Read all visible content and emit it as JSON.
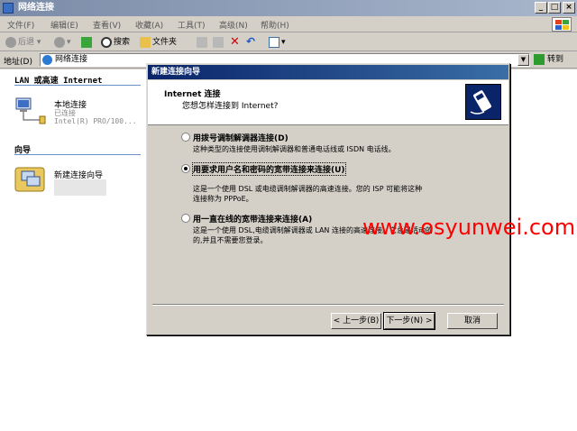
{
  "window": {
    "title": "网络连接"
  },
  "menu": [
    "文件(F)",
    "编辑(E)",
    "查看(V)",
    "收藏(A)",
    "工具(T)",
    "高级(N)",
    "帮助(H)"
  ],
  "toolbar": {
    "back": "后退",
    "search": "搜索",
    "folders": "文件夹"
  },
  "address": {
    "label": "地址(D)",
    "value": "网络连接",
    "go": "转到"
  },
  "sections": {
    "lan_header": "LAN 或高速 Internet",
    "wizard_header": "向导"
  },
  "lan_item": {
    "name": "本地连接",
    "status": "已连接",
    "device": "Intel(R) PRO/100..."
  },
  "wizard_item": {
    "name": "新建连接向导"
  },
  "dialog": {
    "title": "新建连接向导",
    "heading": "Internet 连接",
    "subheading": "您想怎样连接到 Internet?",
    "options": [
      {
        "label": "用拨号调制解调器连接(D)",
        "desc": "这种类型的连接使用调制解调器和普通电话线或 ISDN 电话线。",
        "selected": false
      },
      {
        "label": "用要求用户名和密码的宽带连接来连接(U)",
        "desc1": "这是一个使用 DSL 或电缆调制解调器的高速连接。您的 ISP 可能将这种",
        "desc2": "连接称为 PPPoE。",
        "selected": true
      },
      {
        "label": "用一直在线的宽带连接来连接(A)",
        "desc1": "这是一个使用 DSL,电缆调制解调器或 LAN 连接的高速连接。它总是活动的",
        "desc2": "的,并且不需要您登录。",
        "selected": false
      }
    ],
    "buttons": {
      "back": "< 上一步(B)",
      "next": "下一步(N) >",
      "cancel": "取消"
    }
  },
  "watermark": "www.osyunwei.com"
}
